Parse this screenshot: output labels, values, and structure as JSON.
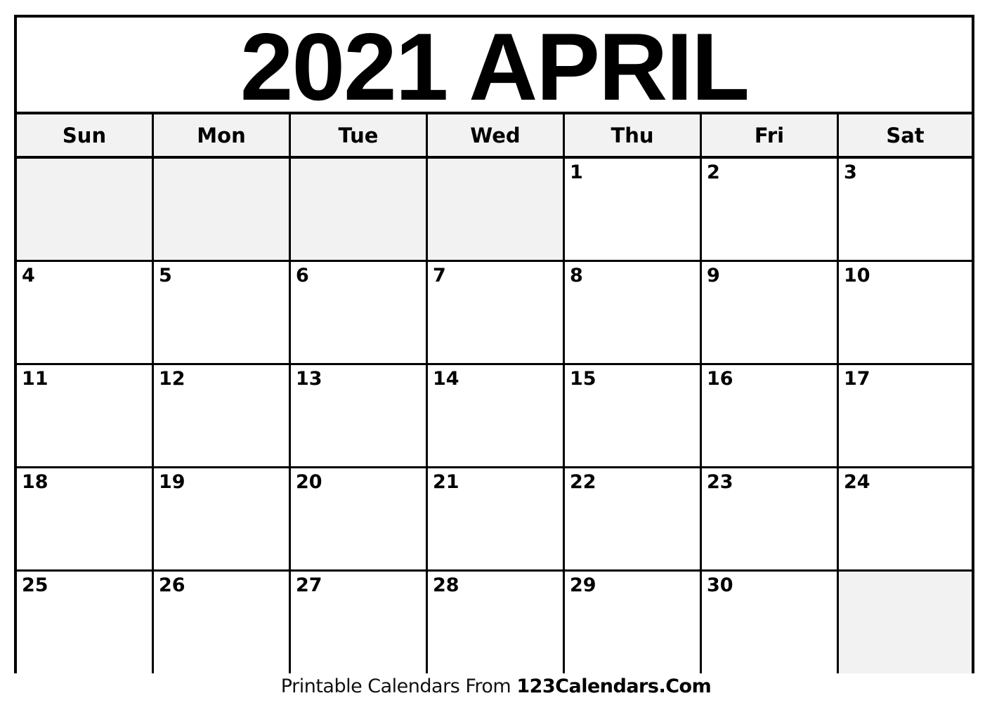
{
  "calendar": {
    "title": "2021 APRIL",
    "year": 2021,
    "month": "APRIL",
    "weekdays": [
      "Sun",
      "Mon",
      "Tue",
      "Wed",
      "Thu",
      "Fri",
      "Sat"
    ],
    "weeks": [
      [
        "",
        "",
        "",
        "",
        "1",
        "2",
        "3"
      ],
      [
        "4",
        "5",
        "6",
        "7",
        "8",
        "9",
        "10"
      ],
      [
        "11",
        "12",
        "13",
        "14",
        "15",
        "16",
        "17"
      ],
      [
        "18",
        "19",
        "20",
        "21",
        "22",
        "23",
        "24"
      ],
      [
        "25",
        "26",
        "27",
        "28",
        "29",
        "30",
        ""
      ]
    ],
    "colors": {
      "border": "#000000",
      "header_bg": "#f2f2f2",
      "empty_cell_bg": "#f2f2f2",
      "cell_bg": "#ffffff"
    }
  },
  "footer": {
    "prefix": "Printable Calendars From ",
    "brand": "123Calendars.Com"
  }
}
